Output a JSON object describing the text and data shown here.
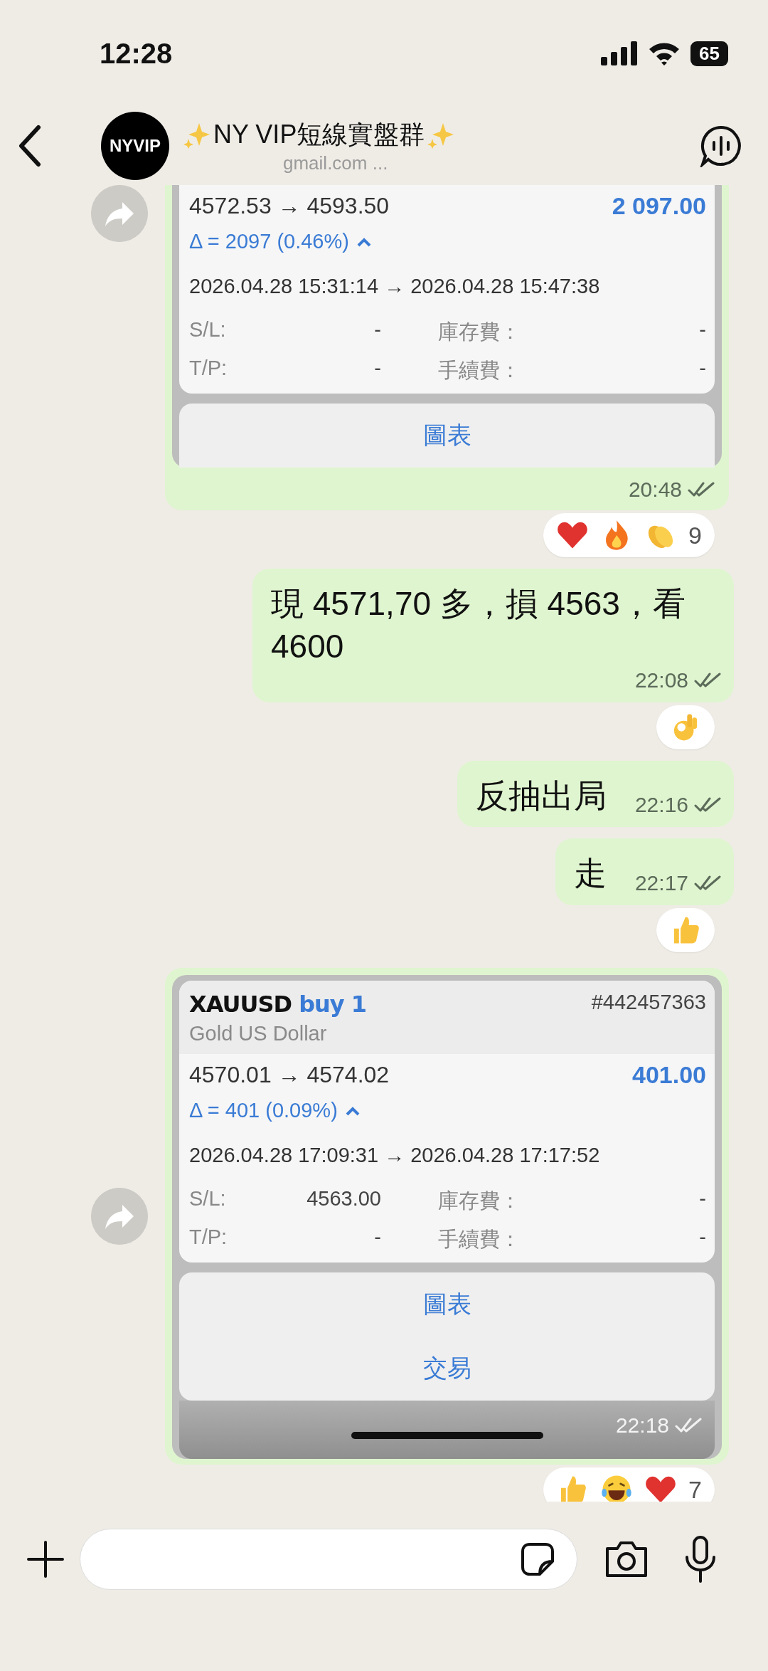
{
  "status_bar": {
    "time": "12:28",
    "battery": "65"
  },
  "header": {
    "avatar_text": "NYVIP",
    "title": "NY VIP短線實盤群",
    "subtitle": "gmail.com ..."
  },
  "messages": [
    {
      "kind": "trade_card",
      "forwarded": true,
      "prices": "4572.53 → 4593.50",
      "profit": "2 097.00",
      "delta": "Δ = 2097 (0.46%)",
      "times": "2026.04.28 15:31:14 → 2026.04.28 15:47:38",
      "fields": [
        {
          "label": "S/L:",
          "value": "-"
        },
        {
          "label": "庫存費：",
          "value": "-"
        },
        {
          "label": "T/P:",
          "value": "-"
        },
        {
          "label": "手續費：",
          "value": "-"
        }
      ],
      "actions": [
        "圖表"
      ],
      "time": "20:48",
      "reactions": {
        "items": [
          {
            "kind": "heart"
          },
          {
            "kind": "fire"
          },
          {
            "kind": "clap"
          }
        ],
        "count": "9"
      }
    },
    {
      "kind": "text",
      "text": "現 4571,70 多，損 4563，看 4600",
      "time": "22:08",
      "reactions": {
        "items": [
          {
            "kind": "ok"
          }
        ]
      }
    },
    {
      "kind": "text",
      "text": "反抽出局",
      "time": "22:16"
    },
    {
      "kind": "text",
      "text": "走",
      "time": "22:17",
      "reactions": {
        "items": [
          {
            "kind": "thumbs"
          }
        ]
      }
    },
    {
      "kind": "trade_card",
      "forwarded": true,
      "symbol": "XAUUSD",
      "side": "buy 1",
      "ticket": "#442457363",
      "description": "Gold US Dollar",
      "prices": "4570.01 → 4574.02",
      "profit": "401.00",
      "delta": "Δ = 401 (0.09%)",
      "times": "2026.04.28 17:09:31 → 2026.04.28 17:17:52",
      "fields": [
        {
          "label": "S/L:",
          "value": "4563.00"
        },
        {
          "label": "庫存費：",
          "value": "-"
        },
        {
          "label": "T/P:",
          "value": "-"
        },
        {
          "label": "手續費：",
          "value": "-"
        }
      ],
      "actions": [
        "圖表",
        "交易"
      ],
      "time": "22:18",
      "reactions": {
        "items": [
          {
            "kind": "thumbs"
          },
          {
            "kind": "laugh"
          },
          {
            "kind": "heart"
          }
        ],
        "count": "7"
      }
    }
  ]
}
